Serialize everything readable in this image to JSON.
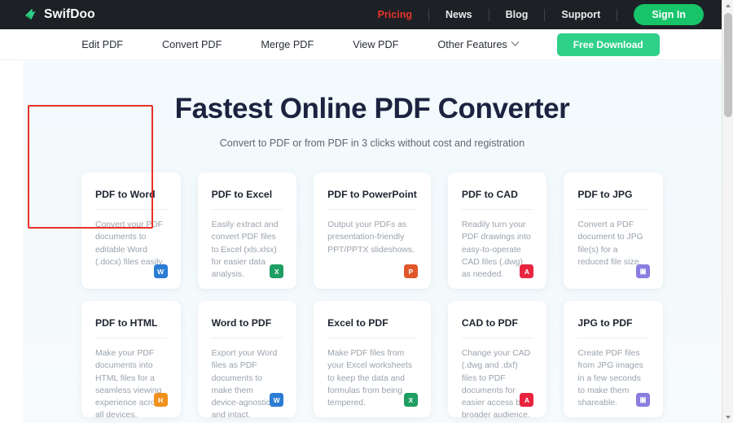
{
  "brand": {
    "name": "SwifDoo",
    "logo_icon": "swifdoo-arrow-logo",
    "logo_color": "#2fd08a"
  },
  "topnav": {
    "links": [
      {
        "label": "Pricing",
        "active": true
      },
      {
        "label": "News",
        "active": false
      },
      {
        "label": "Blog",
        "active": false
      },
      {
        "label": "Support",
        "active": false
      }
    ],
    "signin_label": "Sign In",
    "active_color": "#e8342c",
    "signin_color": "#17c46a",
    "background": "#1d2024"
  },
  "subnav": {
    "links": [
      {
        "label": "Edit PDF",
        "caret": false
      },
      {
        "label": "Convert PDF",
        "caret": false
      },
      {
        "label": "Merge PDF",
        "caret": false
      },
      {
        "label": "View PDF",
        "caret": false
      },
      {
        "label": "Other Features",
        "caret": true
      }
    ],
    "download_label": "Free Download",
    "download_color": "#2fd08a"
  },
  "hero": {
    "title": "Fastest Online PDF Converter",
    "subtitle": "Convert to PDF or from PDF in 3 clicks without cost and registration",
    "title_color": "#1b2340",
    "background": "#f2fafd"
  },
  "cards": [
    {
      "title": "PDF to Word",
      "desc": "Convert your PDF documents to editable Word (.docx) files easily.",
      "icon": "word-file-icon",
      "icon_glyph": "W",
      "icon_color": "#2b7cd3",
      "highlighted": true
    },
    {
      "title": "PDF to Excel",
      "desc": "Easily extract and convert PDF files to Excel (xls.xlsx) for easier data analysis.",
      "icon": "excel-file-icon",
      "icon_glyph": "X",
      "icon_color": "#1e9e62",
      "highlighted": false
    },
    {
      "title": "PDF to PowerPoint",
      "desc": "Output your PDFs as presentation-friendly PPT/PPTX slideshows.",
      "icon": "powerpoint-file-icon",
      "icon_glyph": "P",
      "icon_color": "#e2572a",
      "highlighted": false
    },
    {
      "title": "PDF to CAD",
      "desc": "Readily turn your PDF drawings into easy-to-operate CAD files (.dwg) as needed.",
      "icon": "cad-file-icon",
      "icon_glyph": "A",
      "icon_color": "#e8243f",
      "highlighted": false
    },
    {
      "title": "PDF to JPG",
      "desc": "Convert a PDF document to JPG file(s) for a reduced file size.",
      "icon": "jpg-image-icon",
      "icon_glyph": "▣",
      "icon_color": "#8a7de0",
      "highlighted": false
    },
    {
      "title": "PDF to HTML",
      "desc": "Make your PDF documents into HTML files for a seamless viewing experience across all devices.",
      "icon": "html-file-icon",
      "icon_glyph": "H",
      "icon_color": "#f0911e",
      "highlighted": false
    },
    {
      "title": "Word to PDF",
      "desc": "Export your Word files as PDF documents to make them device-agnostic and intact.",
      "icon": "word-file-icon",
      "icon_glyph": "W",
      "icon_color": "#2b7cd3",
      "highlighted": false
    },
    {
      "title": "Excel to PDF",
      "desc": "Make PDF files from your Excel worksheets to keep the data and formulas from being tempered.",
      "icon": "excel-file-icon",
      "icon_glyph": "X",
      "icon_color": "#1e9e62",
      "highlighted": false
    },
    {
      "title": "CAD to PDF",
      "desc": "Change your CAD (.dwg and .dxf) files to PDF documents for easier access by a broader audience.",
      "icon": "cad-file-icon",
      "icon_glyph": "A",
      "icon_color": "#e8243f",
      "highlighted": false
    },
    {
      "title": "JPG to PDF",
      "desc": "Create PDF files from JPG images in a few seconds to make them shareable.",
      "icon": "jpg-image-icon",
      "icon_glyph": "▣",
      "icon_color": "#8a7de0",
      "highlighted": false
    }
  ],
  "annotation": {
    "color": "#e8312a",
    "target": "PDF to Word"
  }
}
